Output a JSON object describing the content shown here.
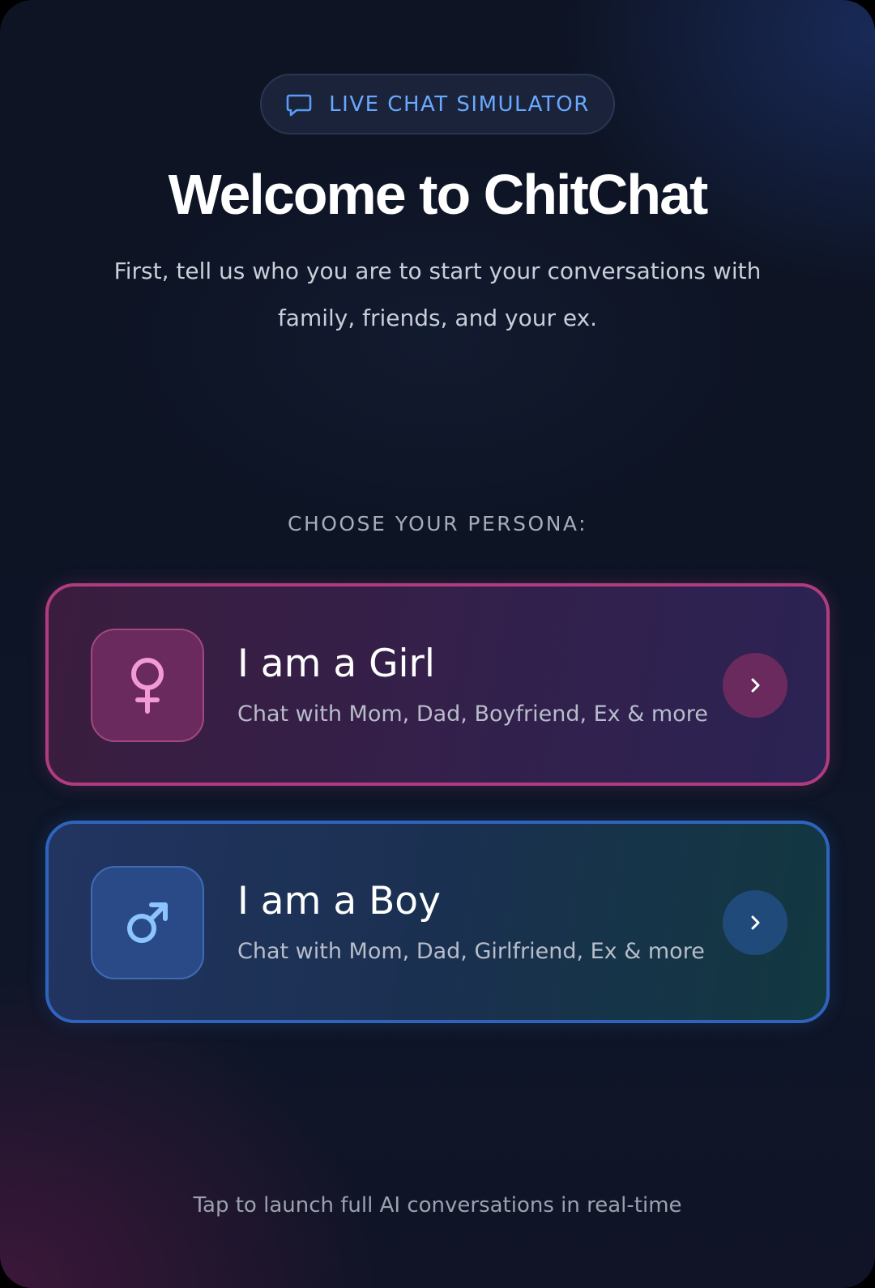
{
  "badge": {
    "icon": "chat-bubble-icon",
    "label": "LIVE CHAT SIMULATOR"
  },
  "header": {
    "title": "Welcome to ChitChat",
    "subtitle": "First, tell us who you are to start your conversations with family, friends, and your ex."
  },
  "persona_section": {
    "label": "CHOOSE YOUR PERSONA:",
    "options": [
      {
        "icon": "female-symbol-icon",
        "title": "I am a Girl",
        "description": "Chat with Mom, Dad, Boyfriend, Ex & more",
        "accent": "#b03c80"
      },
      {
        "icon": "male-symbol-icon",
        "title": "I am a Boy",
        "description": "Chat with Mom, Dad, Girlfriend, Ex & more",
        "accent": "#2f64bd"
      }
    ]
  },
  "footer": {
    "text": "Tap to launch full AI conversations in real-time"
  },
  "colors": {
    "badge_text": "#6aa8ff",
    "girl_icon": "#f29ad6",
    "boy_icon": "#8cc4ff"
  }
}
